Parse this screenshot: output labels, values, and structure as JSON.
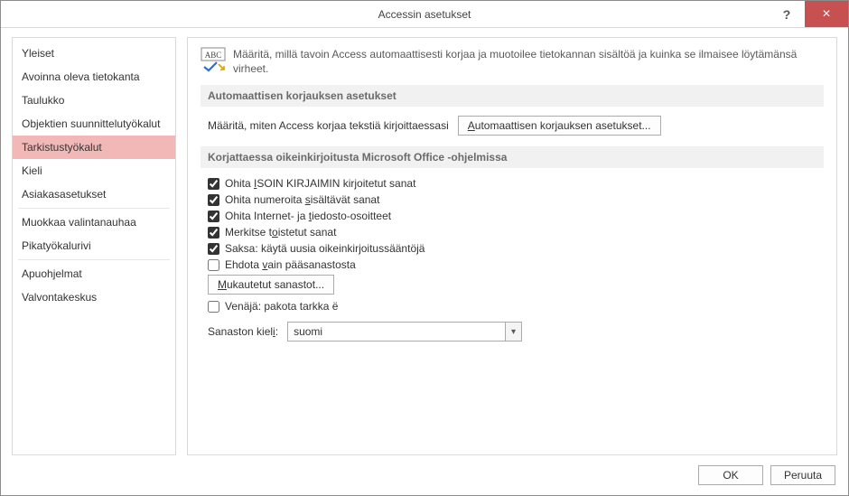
{
  "window": {
    "title": "Accessin asetukset",
    "help_tooltip": "?",
    "close_tooltip": "×"
  },
  "sidebar": {
    "items": [
      {
        "label": "Yleiset",
        "selected": false,
        "sep_after": false
      },
      {
        "label": "Avoinna oleva tietokanta",
        "selected": false,
        "sep_after": false
      },
      {
        "label": "Taulukko",
        "selected": false,
        "sep_after": false
      },
      {
        "label": "Objektien suunnittelutyökalut",
        "selected": false,
        "sep_after": false
      },
      {
        "label": "Tarkistustyökalut",
        "selected": true,
        "sep_after": false
      },
      {
        "label": "Kieli",
        "selected": false,
        "sep_after": false
      },
      {
        "label": "Asiakasasetukset",
        "selected": false,
        "sep_after": true
      },
      {
        "label": "Muokkaa valintanauhaa",
        "selected": false,
        "sep_after": false
      },
      {
        "label": "Pikatyökalurivi",
        "selected": false,
        "sep_after": true
      },
      {
        "label": "Apuohjelmat",
        "selected": false,
        "sep_after": false
      },
      {
        "label": "Valvontakeskus",
        "selected": false,
        "sep_after": false
      }
    ]
  },
  "intro": {
    "text": "Määritä, millä tavoin Access automaattisesti korjaa ja muotoilee tietokannan sisältöä ja kuinka se ilmaisee löytämänsä virheet."
  },
  "section_autocorrect": {
    "header": "Automaattisen korjauksen asetukset",
    "label": "Määritä, miten Access korjaa tekstiä kirjoittaessasi",
    "button": "Automaattisen korjauksen asetukset..."
  },
  "section_spelling": {
    "header": "Korjattaessa oikeinkirjoitusta Microsoft Office -ohjelmissa",
    "checks": [
      {
        "label_pre": "Ohita ",
        "label_u": "I",
        "label_post": "SOIN KIRJAIMIN kirjoitetut sanat",
        "checked": true
      },
      {
        "label_pre": "Ohita numeroita ",
        "label_u": "s",
        "label_post": "isältävät sanat",
        "checked": true
      },
      {
        "label_pre": "Ohita Internet- ja ",
        "label_u": "t",
        "label_post": "iedosto-osoitteet",
        "checked": true
      },
      {
        "label_pre": "Merkitse t",
        "label_u": "o",
        "label_post": "istetut sanat",
        "checked": true
      },
      {
        "label_pre": "Saksa: käytä uusia oikeinkirjoitussääntöjä",
        "label_u": "",
        "label_post": "",
        "checked": true
      },
      {
        "label_pre": "Ehdota ",
        "label_u": "v",
        "label_post": "ain pääsanastosta",
        "checked": false
      }
    ],
    "dict_button_pre": "M",
    "dict_button_u": "",
    "dict_button_label": "Mukautetut sanastot...",
    "russian_check": {
      "label": "Venäjä: pakota tarkka ë",
      "checked": false
    },
    "dict_lang_label_pre": "Sanaston kiel",
    "dict_lang_label_u": "i",
    "dict_lang_label_post": ":",
    "dict_lang_value": "suomi"
  },
  "footer": {
    "ok": "OK",
    "cancel": "Peruuta"
  }
}
